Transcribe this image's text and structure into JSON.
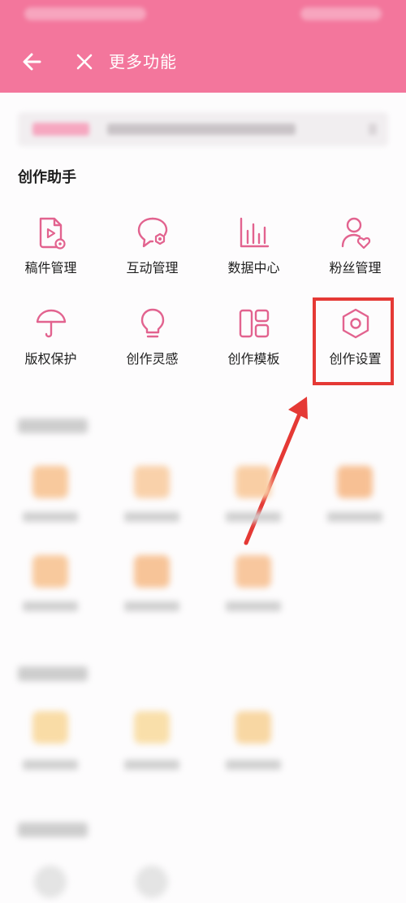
{
  "header": {
    "title": "更多功能",
    "back_icon": "arrow-left-icon",
    "close_icon": "close-icon",
    "background_color": "#f3769c"
  },
  "section": {
    "title": "创作助手"
  },
  "tools": [
    {
      "label": "稿件管理",
      "icon": "manuscript-play-icon"
    },
    {
      "label": "互动管理",
      "icon": "chat-bubble-gear-icon"
    },
    {
      "label": "数据中心",
      "icon": "bar-chart-icon"
    },
    {
      "label": "粉丝管理",
      "icon": "user-heart-icon"
    },
    {
      "label": "版权保护",
      "icon": "umbrella-icon"
    },
    {
      "label": "创作灵感",
      "icon": "lightbulb-icon"
    },
    {
      "label": "创作模板",
      "icon": "layout-template-icon"
    },
    {
      "label": "创作设置",
      "icon": "hexagon-settings-icon"
    }
  ],
  "colors": {
    "icon_accent": "#e2638f",
    "highlight": "#e53935",
    "blurred_icon": "#f7c59a"
  }
}
